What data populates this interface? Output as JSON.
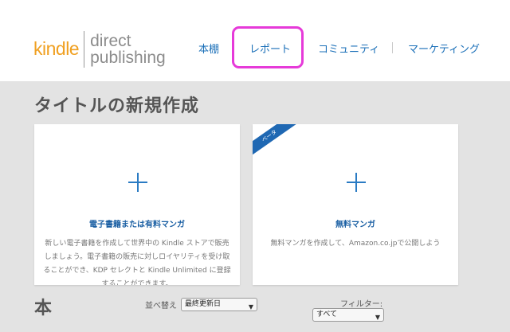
{
  "logo": {
    "kindle": "kindle",
    "line1": "direct",
    "line2": "publishing"
  },
  "nav": {
    "bookshelf": "本棚",
    "reports": "レポート",
    "community": "コミュニティ",
    "marketing": "マーケティング"
  },
  "highlight_color": "#e63ad9",
  "section_title": "タイトルの新規作成",
  "cards": {
    "ebook": {
      "title": "電子書籍または有料マンガ",
      "description": "新しい電子書籍を作成して世界中の Kindle ストアで販売しましょう。電子書籍の販売に対しロイヤリティを受け取ることができ、KDP セレクトと Kindle Unlimited に登録することができます。"
    },
    "comic": {
      "badge": "ベータ",
      "title": "無料マンガ",
      "description": "無料マンガを作成して、Amazon.co.jpで公開しよう"
    }
  },
  "books": {
    "heading": "本",
    "sort_label": "並べ替え",
    "sort_value": "最終更新日",
    "filter_label": "フィルター:",
    "filter_value": "すべて"
  },
  "colors": {
    "accent": "#1a6fb8",
    "logo_orange": "#f0a021",
    "background": "#e3e3e3"
  }
}
